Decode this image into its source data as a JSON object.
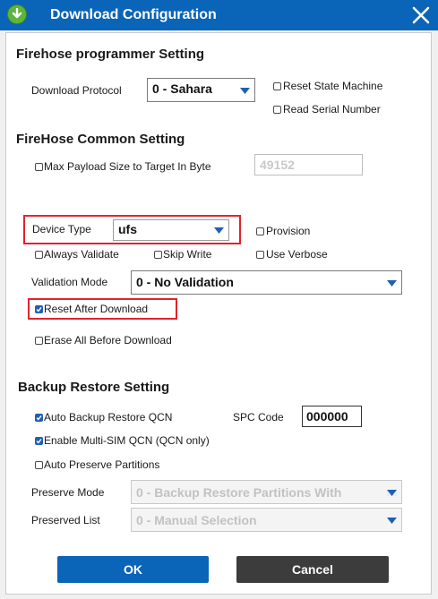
{
  "window": {
    "title": "Download Configuration"
  },
  "firehose_programmer": {
    "heading": "Firehose programmer Setting",
    "download_protocol_label": "Download Protocol",
    "download_protocol_value": "0 - Sahara",
    "reset_state_machine": "Reset State Machine",
    "read_serial_number": "Read Serial Number"
  },
  "firehose_common": {
    "heading": "FireHose Common Setting",
    "max_payload_label": "Max Payload Size to Target In Byte",
    "max_payload_value": "49152",
    "device_type_label": "Device Type",
    "device_type_value": "ufs",
    "provision": "Provision",
    "always_validate": "Always Validate",
    "skip_write": "Skip Write",
    "use_verbose": "Use Verbose",
    "validation_mode_label": "Validation Mode",
    "validation_mode_value": "0 - No Validation",
    "reset_after_download": "Reset After Download",
    "reset_after_download_checked": true,
    "erase_all_before_download": "Erase All Before Download"
  },
  "backup_restore": {
    "heading": "Backup Restore Setting",
    "auto_backup_restore_qcn": "Auto Backup Restore QCN",
    "auto_backup_restore_qcn_checked": true,
    "spc_code_label": "SPC Code",
    "spc_code_value": "000000",
    "enable_multi_sim_qcn": "Enable Multi-SIM QCN (QCN only)",
    "enable_multi_sim_qcn_checked": true,
    "auto_preserve_partitions": "Auto Preserve Partitions",
    "preserve_mode_label": "Preserve Mode",
    "preserve_mode_value": "0 - Backup Restore Partitions With",
    "preserved_list_label": "Preserved List",
    "preserved_list_value": "0 - Manual Selection"
  },
  "buttons": {
    "ok": "OK",
    "cancel": "Cancel"
  },
  "colors": {
    "title_bar": "#0a64b7",
    "ok_button": "#0a64b7",
    "cancel_button": "#3c3c3c",
    "highlight_box": "#e0242f",
    "checkbox_checked": "#1f5fb4"
  },
  "icons": {
    "app": "download-arrow-icon",
    "close": "close-icon",
    "dropdown": "dropdown-arrow-icon"
  }
}
